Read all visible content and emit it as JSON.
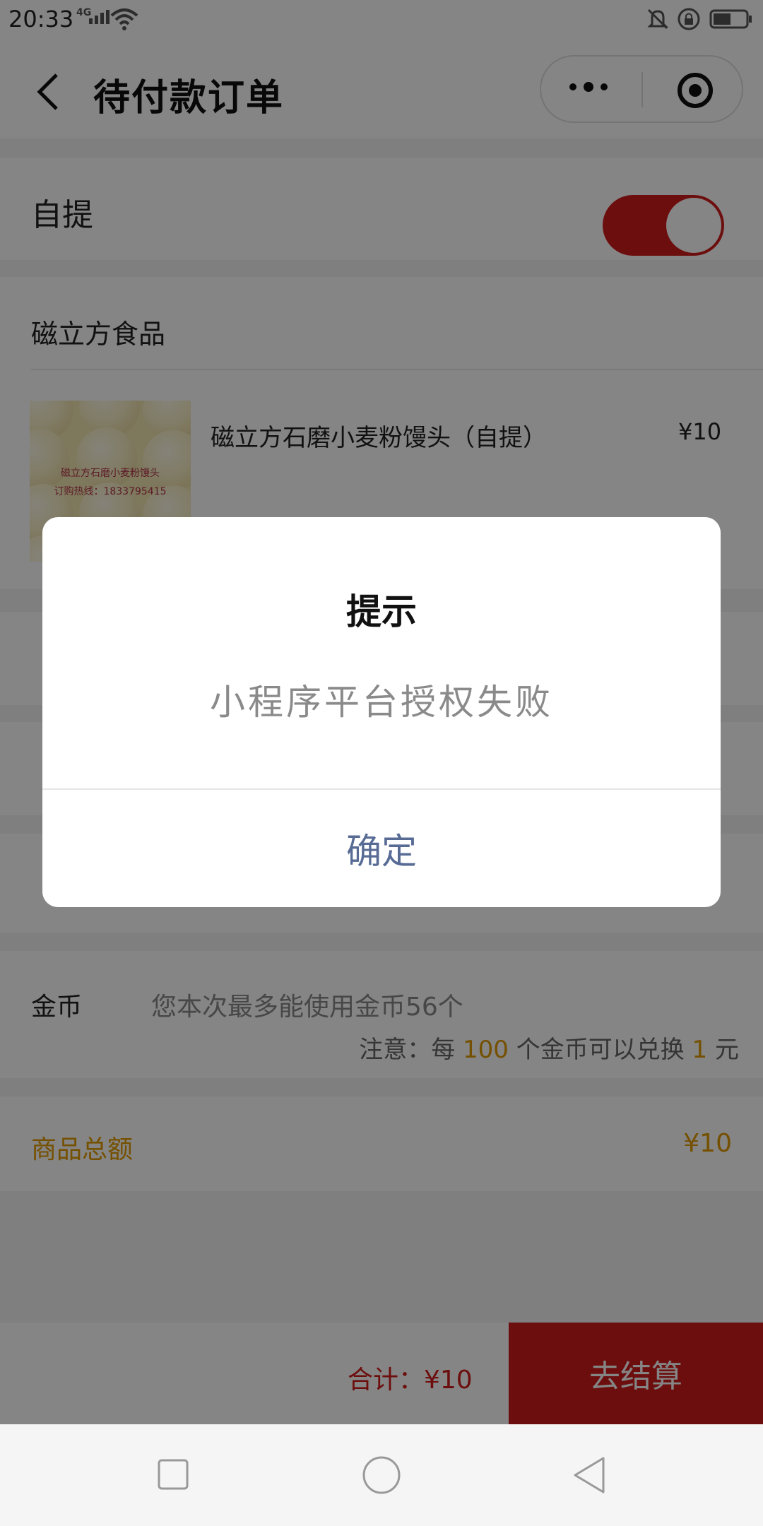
{
  "status_bar": {
    "time": "20:33",
    "network": "4G"
  },
  "header": {
    "title": "待付款订单"
  },
  "pickup": {
    "label": "自提",
    "enabled": true
  },
  "store": {
    "name": "磁立方食品"
  },
  "product": {
    "name": "磁立方石磨小麦粉馒头（自提）",
    "price": "¥10",
    "image_text_line1": "磁立方石磨小麦粉馒头",
    "image_text_line2": "订购热线：1833795415"
  },
  "coins": {
    "label": "金币",
    "text": "您本次最多能使用金币56个",
    "note_prefix": "注意：每",
    "note_amount": "100",
    "note_middle": "个金币可以兑换",
    "note_value": "1",
    "note_suffix": "元"
  },
  "total": {
    "label": "商品总额",
    "value": "¥10"
  },
  "bottom": {
    "sum": "合计：¥10",
    "pay_button": "去结算"
  },
  "modal": {
    "title": "提示",
    "message": "小程序平台授权失败",
    "confirm": "确定"
  },
  "colors": {
    "accent_red": "#d11b1b",
    "highlight_orange": "#e09a00",
    "modal_button": "#576b95"
  }
}
